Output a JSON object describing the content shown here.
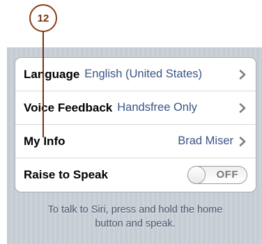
{
  "callout": {
    "number": "12"
  },
  "settings": {
    "rows": [
      {
        "label": "Language",
        "value": "English (United States)"
      },
      {
        "label": "Voice Feedback",
        "value": "Handsfree Only"
      },
      {
        "label": "My Info",
        "value": "Brad Miser"
      },
      {
        "label": "Raise to Speak",
        "toggle": "OFF"
      }
    ],
    "footer_line1": "To talk to Siri, press and hold the home",
    "footer_line2": "button and speak."
  },
  "icons": {
    "chevron": "chevron-right-icon"
  },
  "colors": {
    "value_text": "#385487",
    "callout": "#7a3214",
    "background": "#c5ccd4"
  }
}
